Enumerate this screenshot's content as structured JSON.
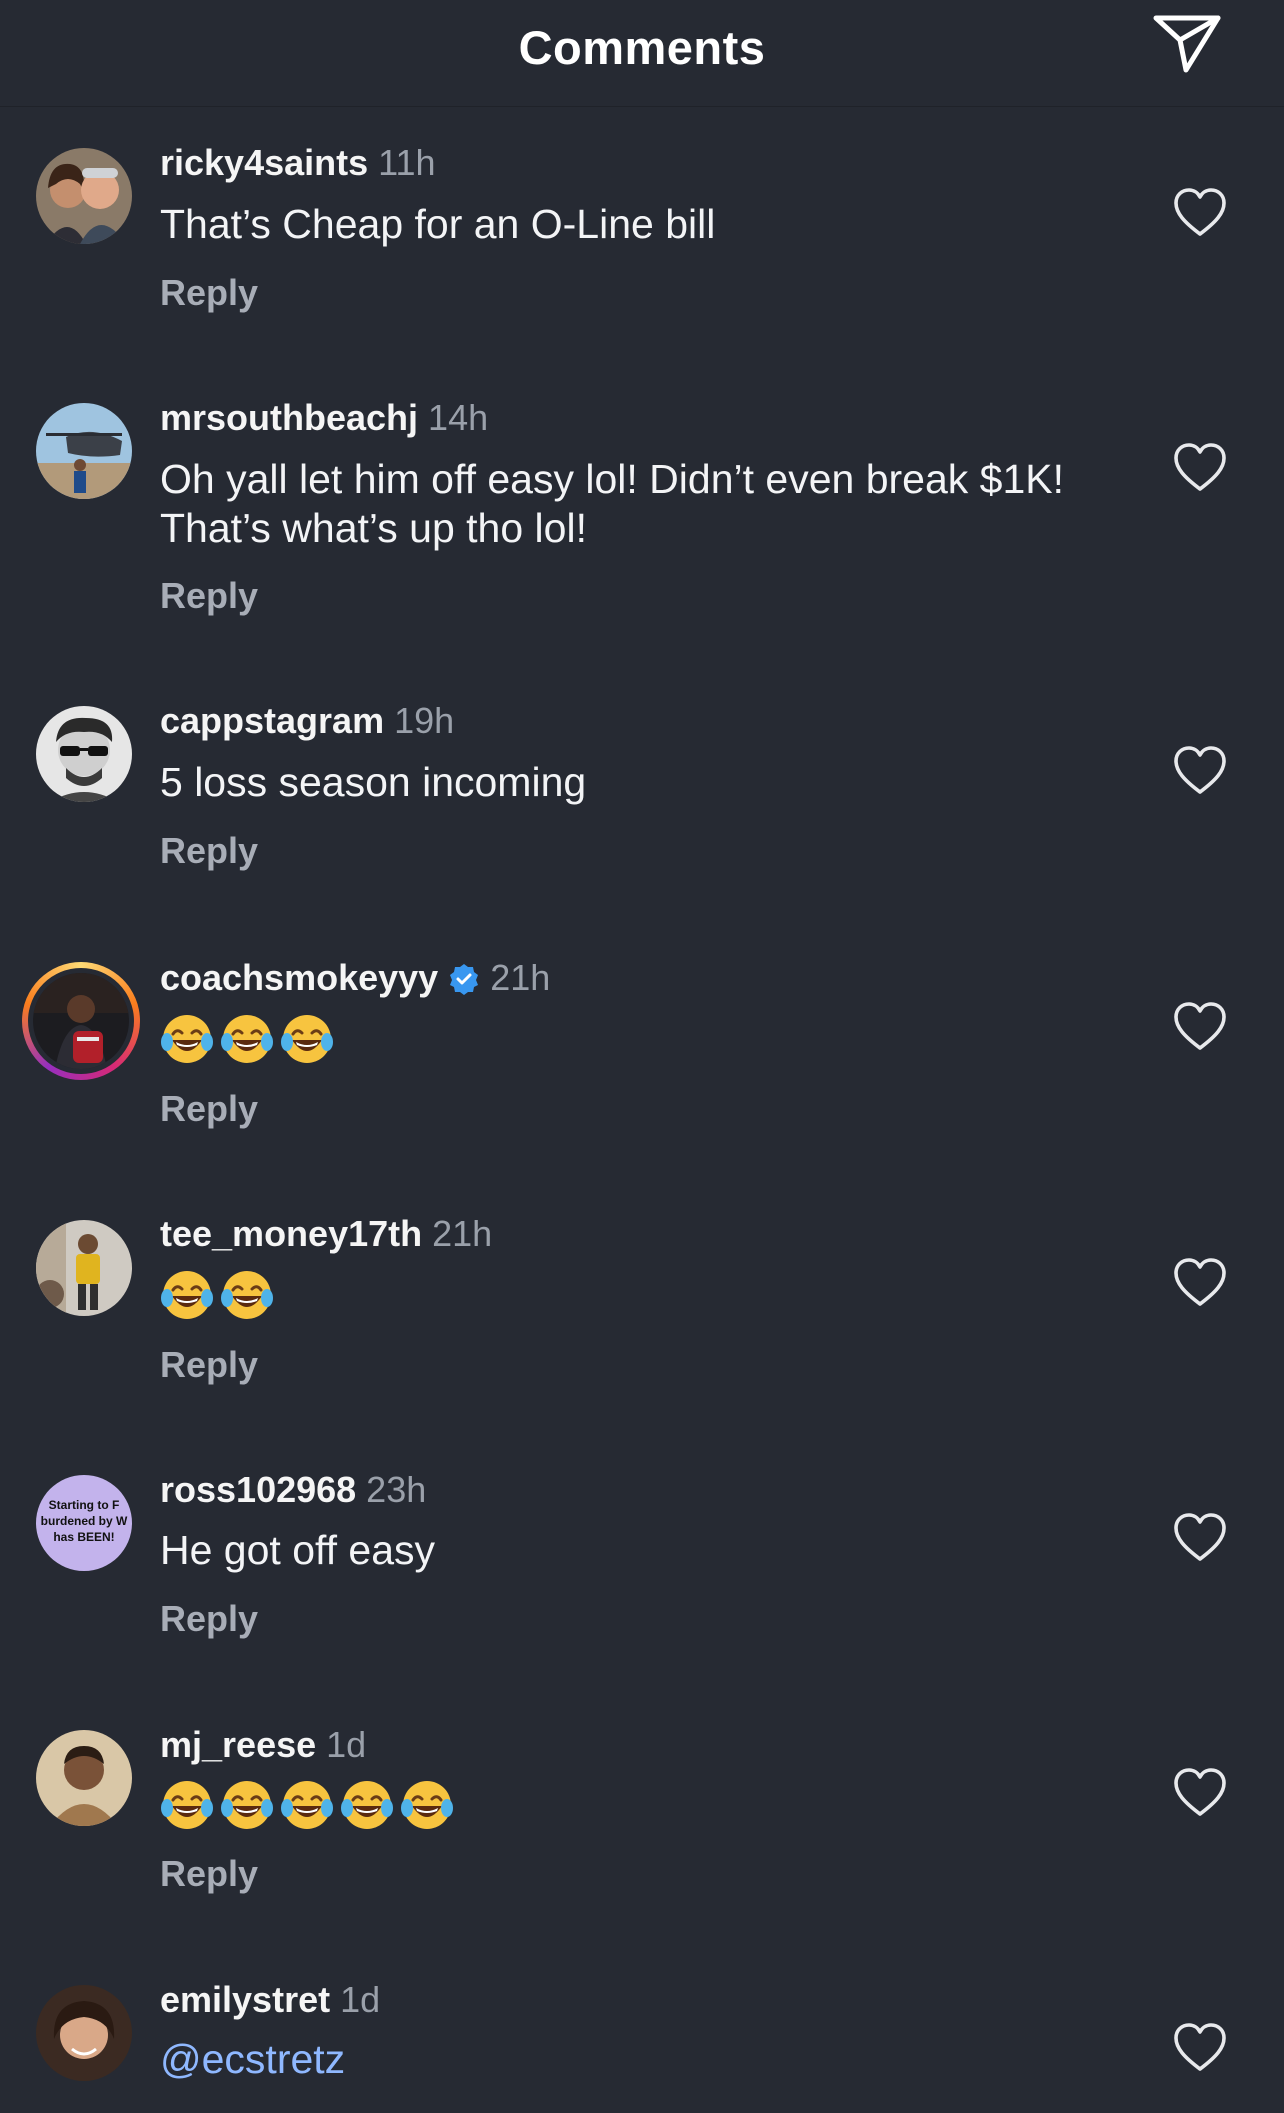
{
  "header": {
    "title": "Comments"
  },
  "reply_label": "Reply",
  "comments": [
    {
      "username": "ricky4saints",
      "time": "11h",
      "text": "That’s Cheap for an O-Line bill"
    },
    {
      "username": "mrsouthbeachj",
      "time": "14h",
      "text_line1": "Oh yall let him off easy lol! Didn’t even break $1K!",
      "text_line2": "That’s what’s up tho lol!"
    },
    {
      "username": "cappstagram",
      "time": "19h",
      "text": "5 loss season incoming"
    },
    {
      "username": "coachsmokeyyy",
      "time": "21h",
      "verified": true,
      "emoji_count": 3,
      "emoji": "face-with-tears-of-joy"
    },
    {
      "username": "tee_money17th",
      "time": "21h",
      "emoji_count": 2,
      "emoji": "face-with-tears-of-joy"
    },
    {
      "username": "ross102968",
      "time": "23h",
      "text": "He got off easy",
      "avatar_text_line1": "Starting to F",
      "avatar_text_line2": "burdened by W",
      "avatar_text_line3": "has BEEN!"
    },
    {
      "username": "mj_reese",
      "time": "1d",
      "emoji_count": 5,
      "emoji": "face-with-tears-of-joy"
    },
    {
      "username": "emilystret",
      "time": "1d",
      "text": "@ecstretz"
    }
  ],
  "colors": {
    "background": "#262a33",
    "primary_text": "#f3f4f6",
    "secondary_text": "#9aa0aa",
    "mention": "#8fb8ff",
    "verified_badge": "#3897f0"
  }
}
